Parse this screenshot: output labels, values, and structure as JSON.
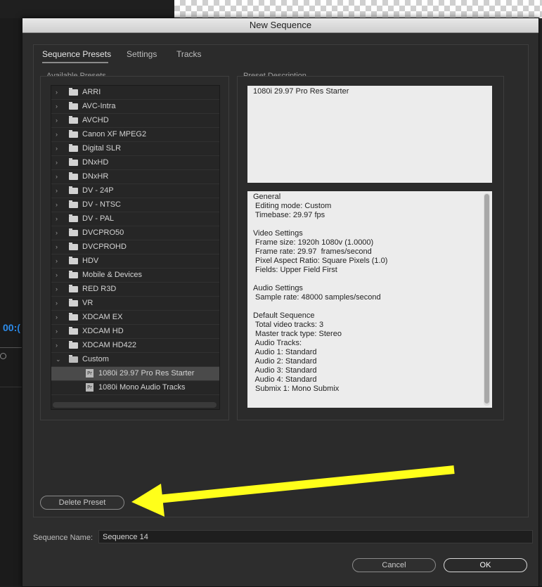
{
  "dialog": {
    "title": "New Sequence"
  },
  "tabs": [
    {
      "label": "Sequence Presets",
      "active": true
    },
    {
      "label": "Settings",
      "active": false
    },
    {
      "label": "Tracks",
      "active": false
    }
  ],
  "available_presets": {
    "label": "Available Presets",
    "folders": [
      {
        "label": "ARRI"
      },
      {
        "label": "AVC-Intra"
      },
      {
        "label": "AVCHD"
      },
      {
        "label": "Canon XF MPEG2"
      },
      {
        "label": "Digital SLR"
      },
      {
        "label": "DNxHD"
      },
      {
        "label": "DNxHR"
      },
      {
        "label": "DV - 24P"
      },
      {
        "label": "DV - NTSC"
      },
      {
        "label": "DV - PAL"
      },
      {
        "label": "DVCPRO50"
      },
      {
        "label": "DVCPROHD"
      },
      {
        "label": "HDV"
      },
      {
        "label": "Mobile & Devices"
      },
      {
        "label": "RED R3D"
      },
      {
        "label": "VR"
      },
      {
        "label": "XDCAM EX"
      },
      {
        "label": "XDCAM HD"
      },
      {
        "label": "XDCAM HD422"
      }
    ],
    "custom_folder": {
      "label": "Custom",
      "expanded": true,
      "items": [
        {
          "label": "1080i 29.97 Pro Res Starter",
          "selected": true
        },
        {
          "label": "1080i Mono Audio Tracks",
          "selected": false
        }
      ]
    },
    "file_icon_glyph": "Pr"
  },
  "preset_description": {
    "label": "Preset Description",
    "name": "1080i 29.97 Pro Res Starter",
    "details": [
      "General",
      " Editing mode: Custom",
      " Timebase: 29.97 fps",
      "",
      "Video Settings",
      " Frame size: 1920h 1080v (1.0000)",
      " Frame rate: 29.97  frames/second",
      " Pixel Aspect Ratio: Square Pixels (1.0)",
      " Fields: Upper Field First",
      "",
      "Audio Settings",
      " Sample rate: 48000 samples/second",
      "",
      "Default Sequence",
      " Total video tracks: 3",
      " Master track type: Stereo",
      " Audio Tracks:",
      " Audio 1: Standard",
      " Audio 2: Standard",
      " Audio 3: Standard",
      " Audio 4: Standard",
      " Submix 1: Mono Submix"
    ]
  },
  "buttons": {
    "delete_preset": "Delete Preset",
    "cancel": "Cancel",
    "ok": "OK"
  },
  "sequence_name": {
    "label": "Sequence Name:",
    "value": "Sequence 14"
  },
  "background": {
    "timecode_fragment": "00:("
  },
  "colors": {
    "annotation_arrow": "#ffff1a",
    "timecode": "#2d8ceb"
  }
}
